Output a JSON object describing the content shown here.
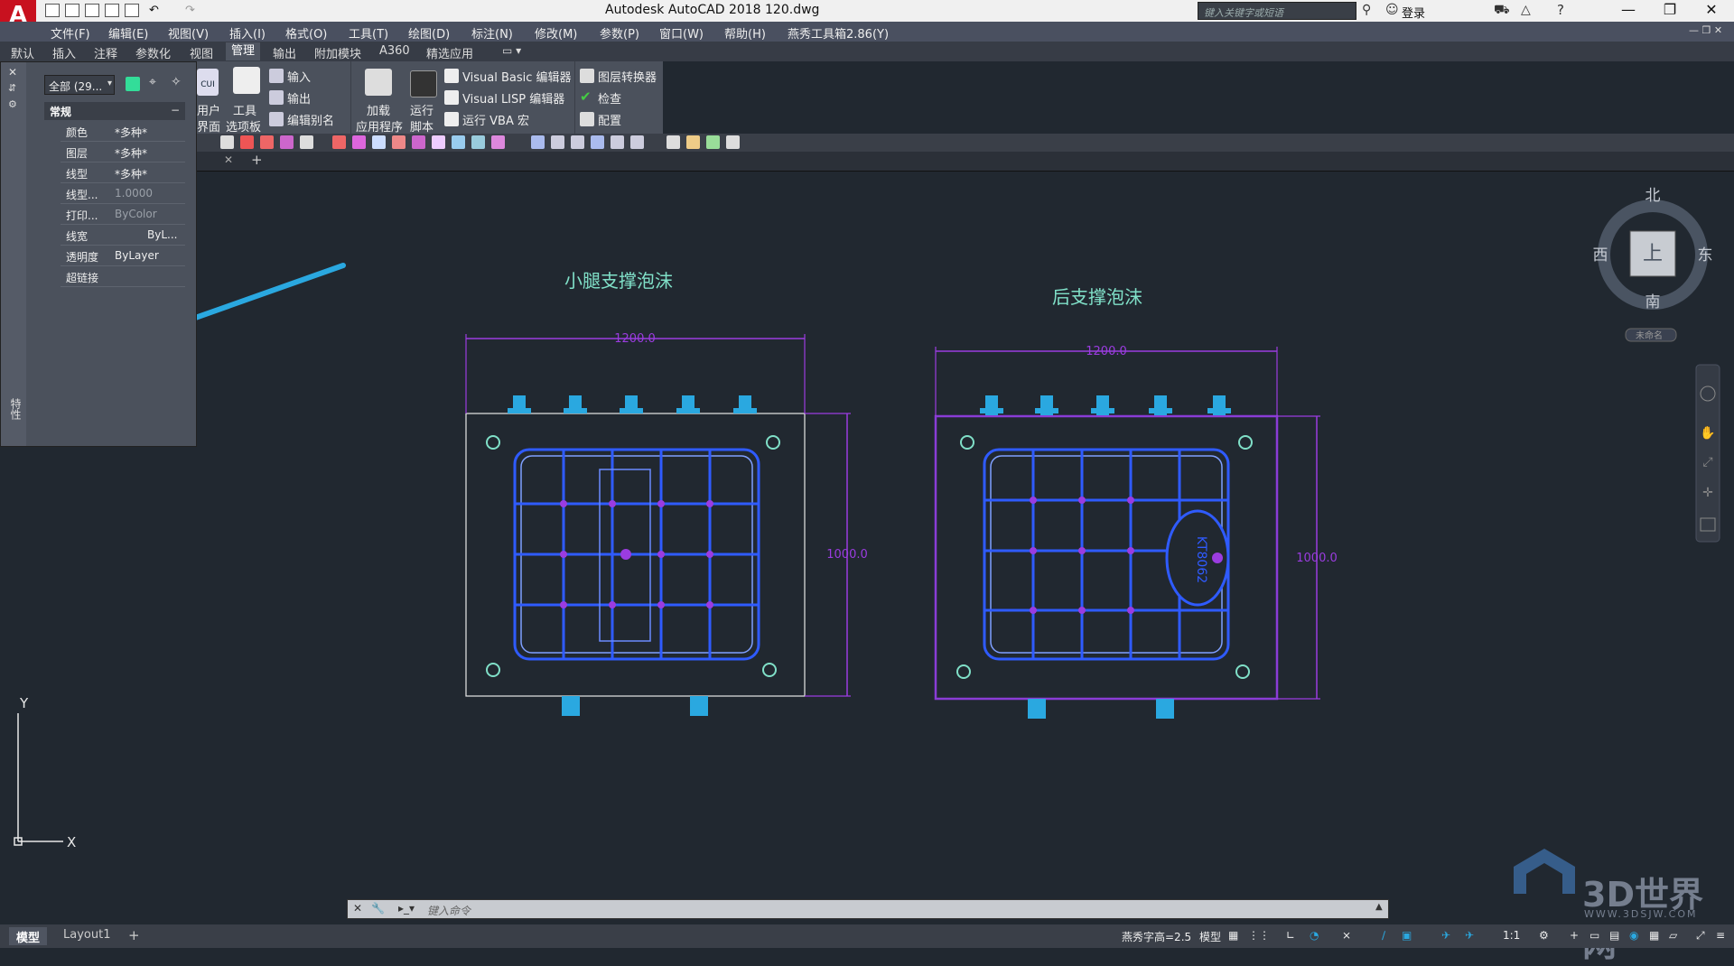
{
  "app": {
    "logo": "A",
    "title": "Autodesk AutoCAD 2018    120.dwg",
    "search_placeholder": "键入关键字或短语",
    "login": "登录"
  },
  "menu": [
    "文件(F)",
    "编辑(E)",
    "视图(V)",
    "插入(I)",
    "格式(O)",
    "工具(T)",
    "绘图(D)",
    "标注(N)",
    "修改(M)",
    "参数(P)",
    "窗口(W)",
    "帮助(H)",
    "燕秀工具箱2.86(Y)"
  ],
  "ribbon_tabs": [
    "默认",
    "插入",
    "注释",
    "参数化",
    "视图",
    "管理",
    "输出",
    "附加模块",
    "A360",
    "精选应用"
  ],
  "ribbon_active_tab": "管理",
  "ribbon": {
    "user_interface": "用户\n界面",
    "user_interface_a": "用户",
    "user_interface_b": "界面",
    "tool_palette_a": "工具",
    "tool_palette_b": "选项板",
    "import": "输入",
    "export": "输出",
    "edit_alias": "编辑别名",
    "load_app_a": "加载",
    "load_app_b": "应用程序",
    "run_script_a": "运行",
    "run_script_b": "脚本",
    "vb_editor": "Visual Basic 编辑器",
    "lisp_editor": "Visual LISP 编辑器",
    "run_vba": "运行 VBA 宏",
    "layer_translator": "图层转换器",
    "check": "检查",
    "configure": "配置",
    "cui_label": "CUI"
  },
  "properties": {
    "selection": "全部 (29...",
    "section": "常规",
    "side_label": "特性",
    "rows": [
      {
        "label": "颜色",
        "value": "*多种*"
      },
      {
        "label": "图层",
        "value": "*多种*"
      },
      {
        "label": "线型",
        "value": "*多种*"
      },
      {
        "label": "线型...",
        "value": "1.0000"
      },
      {
        "label": "打印...",
        "value": "ByColor"
      },
      {
        "label": "线宽",
        "value": "ByL..."
      },
      {
        "label": "透明度",
        "value": "ByLayer"
      },
      {
        "label": "超链接",
        "value": ""
      }
    ]
  },
  "drawing": {
    "left_title": "小腿支撑泡沫",
    "right_title": "后支撑泡沫",
    "left_width_dim": "1200.0",
    "left_height_dim": "1000.0",
    "right_width_dim": "1200.0",
    "right_height_dim": "1000.0",
    "right_stamp": "KT8062"
  },
  "viewcube": {
    "north": "北",
    "south": "南",
    "east": "东",
    "west": "西",
    "face": "上",
    "wcs": "未命名"
  },
  "ucs": {
    "x": "X",
    "y": "Y"
  },
  "command_placeholder": "键入命令",
  "layout_tabs": [
    "模型",
    "Layout1"
  ],
  "status": {
    "text_height": "燕秀字高=2.5",
    "model": "模型",
    "scale": "1:1"
  },
  "watermark": {
    "brand": "3D世界网",
    "url": "WWW.3DSJW.COM"
  },
  "colors": {
    "accent_blue": "#2aa8e0",
    "line_purple": "#8a3cd6",
    "line_blue": "#2f5bff",
    "title_teal": "#80e0c8"
  }
}
